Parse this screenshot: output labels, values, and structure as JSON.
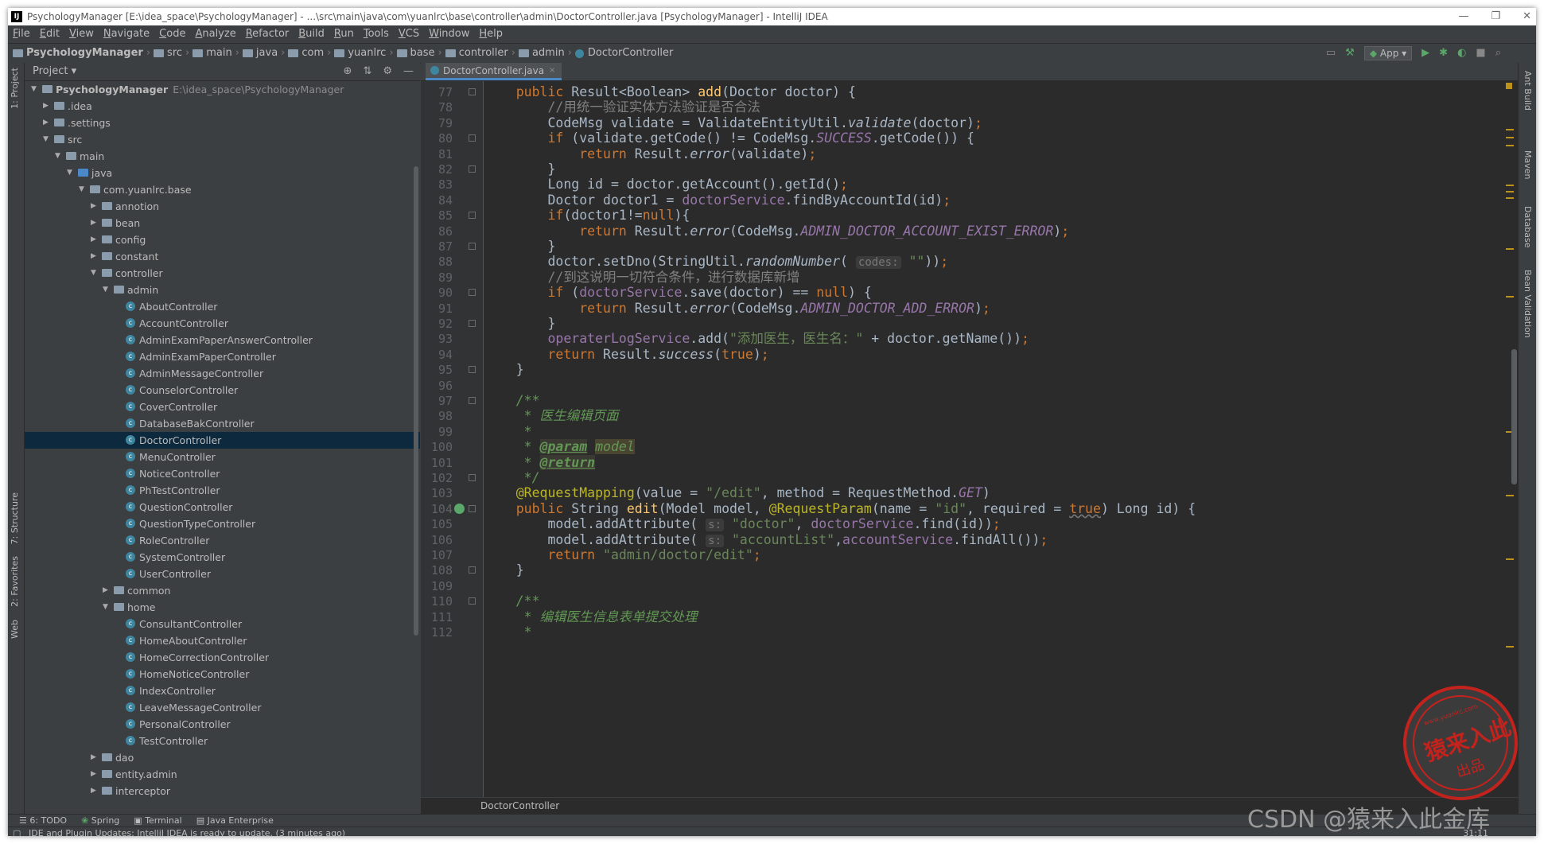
{
  "window": {
    "title": "PsychologyManager [E:\\idea_space\\PsychologyManager] - ...\\src\\main\\java\\com\\yuanlrc\\base\\controller\\admin\\DoctorController.java [PsychologyManager] - IntelliJ IDEA",
    "app_icon": "IJ",
    "min": "—",
    "restore": "❐",
    "close": "✕"
  },
  "menu": [
    "File",
    "Edit",
    "View",
    "Navigate",
    "Code",
    "Analyze",
    "Refactor",
    "Build",
    "Run",
    "Tools",
    "VCS",
    "Window",
    "Help"
  ],
  "navbar": {
    "crumbs": [
      "PsychologyManager",
      "src",
      "main",
      "java",
      "com",
      "yuanlrc",
      "base",
      "controller",
      "admin"
    ],
    "current": "DoctorController",
    "run_config": "App",
    "tool_icons": [
      "layout-icon",
      "hammer-icon"
    ],
    "run_icons": [
      "run-icon",
      "debug-icon",
      "coverage-icon",
      "stop-icon",
      "search-icon"
    ]
  },
  "left_tabs": [
    "1: Project",
    "7: Structure",
    "2: Favorites",
    "Web"
  ],
  "right_tabs": [
    "Ant Build",
    "Maven",
    "Database",
    "Bean Validation"
  ],
  "project": {
    "title": "Project",
    "dropdown": "▾",
    "tree": [
      {
        "depth": 0,
        "type": "proj",
        "label": "PsychologyManager",
        "path": "E:\\idea_space\\PsychologyManager",
        "arrow": "▼",
        "bold": true
      },
      {
        "depth": 1,
        "type": "folder",
        "label": ".idea",
        "arrow": "▶"
      },
      {
        "depth": 1,
        "type": "folder",
        "label": ".settings",
        "arrow": "▶"
      },
      {
        "depth": 1,
        "type": "folder",
        "label": "src",
        "arrow": "▼"
      },
      {
        "depth": 2,
        "type": "folder",
        "label": "main",
        "arrow": "▼"
      },
      {
        "depth": 3,
        "type": "src",
        "label": "java",
        "arrow": "▼"
      },
      {
        "depth": 4,
        "type": "folder",
        "label": "com.yuanlrc.base",
        "arrow": "▼"
      },
      {
        "depth": 5,
        "type": "folder",
        "label": "annotion",
        "arrow": "▶"
      },
      {
        "depth": 5,
        "type": "folder",
        "label": "bean",
        "arrow": "▶"
      },
      {
        "depth": 5,
        "type": "folder",
        "label": "config",
        "arrow": "▶"
      },
      {
        "depth": 5,
        "type": "folder",
        "label": "constant",
        "arrow": "▶"
      },
      {
        "depth": 5,
        "type": "folder",
        "label": "controller",
        "arrow": "▼"
      },
      {
        "depth": 6,
        "type": "folder",
        "label": "admin",
        "arrow": "▼"
      },
      {
        "depth": 7,
        "type": "class",
        "label": "AboutController"
      },
      {
        "depth": 7,
        "type": "class",
        "label": "AccountController"
      },
      {
        "depth": 7,
        "type": "class",
        "label": "AdminExamPaperAnswerController"
      },
      {
        "depth": 7,
        "type": "class",
        "label": "AdminExamPaperController"
      },
      {
        "depth": 7,
        "type": "class",
        "label": "AdminMessageController"
      },
      {
        "depth": 7,
        "type": "class",
        "label": "CounselorController"
      },
      {
        "depth": 7,
        "type": "class",
        "label": "CoverController"
      },
      {
        "depth": 7,
        "type": "class",
        "label": "DatabaseBakController"
      },
      {
        "depth": 7,
        "type": "class",
        "label": "DoctorController",
        "selected": true
      },
      {
        "depth": 7,
        "type": "class",
        "label": "MenuController"
      },
      {
        "depth": 7,
        "type": "class",
        "label": "NoticeController"
      },
      {
        "depth": 7,
        "type": "class",
        "label": "PhTestController"
      },
      {
        "depth": 7,
        "type": "class",
        "label": "QuestionController"
      },
      {
        "depth": 7,
        "type": "class",
        "label": "QuestionTypeController"
      },
      {
        "depth": 7,
        "type": "class",
        "label": "RoleController"
      },
      {
        "depth": 7,
        "type": "class",
        "label": "SystemController"
      },
      {
        "depth": 7,
        "type": "class",
        "label": "UserController"
      },
      {
        "depth": 6,
        "type": "folder",
        "label": "common",
        "arrow": "▶"
      },
      {
        "depth": 6,
        "type": "folder",
        "label": "home",
        "arrow": "▼"
      },
      {
        "depth": 7,
        "type": "class",
        "label": "ConsultantController"
      },
      {
        "depth": 7,
        "type": "class",
        "label": "HomeAboutController"
      },
      {
        "depth": 7,
        "type": "class",
        "label": "HomeCorrectionController"
      },
      {
        "depth": 7,
        "type": "class",
        "label": "HomeNoticeController"
      },
      {
        "depth": 7,
        "type": "class",
        "label": "IndexController"
      },
      {
        "depth": 7,
        "type": "class",
        "label": "LeaveMessageController"
      },
      {
        "depth": 7,
        "type": "class",
        "label": "PersonalController"
      },
      {
        "depth": 7,
        "type": "class",
        "label": "TestController"
      },
      {
        "depth": 5,
        "type": "folder",
        "label": "dao",
        "arrow": "▶"
      },
      {
        "depth": 5,
        "type": "folder",
        "label": "entity.admin",
        "arrow": "▶"
      },
      {
        "depth": 5,
        "type": "folder",
        "label": "interceptor",
        "arrow": "▶"
      }
    ]
  },
  "editor": {
    "tab": "DoctorController.java",
    "tab_close": "×",
    "bottom_breadcrumb": "DoctorController",
    "lines": [
      {
        "n": "77",
        "fold": true,
        "html": "    <span class='kw'>public</span> Result&lt;Boolean&gt; <span class='fn'>add</span>(Doctor doctor) {"
      },
      {
        "n": "78",
        "html": "        <span class='cmt'>//用统一验证实体方法验证是否合法</span>"
      },
      {
        "n": "79",
        "html": "        CodeMsg validate = ValidateEntityUtil.<span class='it'>validate</span>(doctor)<span class='kw'>;</span>"
      },
      {
        "n": "80",
        "fold": true,
        "html": "        <span class='kw'>if</span> (validate.getCode() != CodeMsg.<span class='fi'>SUCCESS</span>.getCode()) {"
      },
      {
        "n": "81",
        "html": "            <span class='kw'>return</span> Result.<span class='it'>error</span>(validate)<span class='kw'>;</span>"
      },
      {
        "n": "82",
        "fold": true,
        "html": "        }"
      },
      {
        "n": "83",
        "html": "        Long id = doctor.getAccount().getId()<span class='kw'>;</span>"
      },
      {
        "n": "84",
        "html": "        Doctor doctor1 = <span class='field'>doctorService</span>.findByAccountId(id)<span class='kw'>;</span>"
      },
      {
        "n": "85",
        "fold": true,
        "html": "        <span class='kw'>if</span>(doctor1!=<span class='kw'>null</span>){"
      },
      {
        "n": "86",
        "html": "            <span class='kw'>return</span> Result.<span class='it'>error</span>(CodeMsg.<span class='fi'>ADMIN_DOCTOR_ACCOUNT_EXIST_ERROR</span>)<span class='kw'>;</span>"
      },
      {
        "n": "87",
        "fold": true,
        "html": "        }"
      },
      {
        "n": "88",
        "html": "        doctor.setDno(StringUtil.<span class='it'>randomNumber</span>( <span class='hint'>codes:</span> <span class='str'>\"\"</span>))<span class='kw'>;</span>"
      },
      {
        "n": "89",
        "html": "        <span class='cmt'>//到这说明一切符合条件，进行数据库新增</span>"
      },
      {
        "n": "90",
        "fold": true,
        "html": "        <span class='kw'>if</span> (<span class='field'>doctorService</span>.save(doctor) == <span class='kw'>null</span>) {"
      },
      {
        "n": "91",
        "html": "            <span class='kw'>return</span> Result.<span class='it'>error</span>(CodeMsg.<span class='fi'>ADMIN_DOCTOR_ADD_ERROR</span>)<span class='kw'>;</span>"
      },
      {
        "n": "92",
        "fold": true,
        "html": "        }"
      },
      {
        "n": "93",
        "html": "        <span class='field'>operaterLogService</span>.add(<span class='str'>\"添加医生，医生名：\"</span> + doctor.getName())<span class='kw'>;</span>"
      },
      {
        "n": "94",
        "html": "        <span class='kw'>return</span> Result.<span class='it'>success</span>(<span class='kw'>true</span>)<span class='kw'>;</span>"
      },
      {
        "n": "95",
        "fold": true,
        "html": "    }"
      },
      {
        "n": "96",
        "html": ""
      },
      {
        "n": "97",
        "fold": true,
        "html": "    <span class='doc'>/**</span>"
      },
      {
        "n": "98",
        "html": "     <span class='doc'>* 医生编辑页面</span>"
      },
      {
        "n": "99",
        "html": "     <span class='doc'>*</span>"
      },
      {
        "n": "100",
        "html": "     <span class='doc'>* </span><span class='doctag'>@param</span> <span class='doc' style='background:#4a4530'>model</span>"
      },
      {
        "n": "101",
        "html": "     <span class='doc'>* </span><span class='doctag'>@return</span>"
      },
      {
        "n": "102",
        "fold": true,
        "html": "     <span class='doc'>*/</span>"
      },
      {
        "n": "103",
        "html": "    <span class='ann'>@RequestMapping</span>(value = <span class='str'>\"/edit\"</span>, method = RequestMethod.<span class='fi'>GET</span>)"
      },
      {
        "n": "104",
        "fold": true,
        "bean": true,
        "html": "    <span class='kw'>public</span> String <span class='fn'>edit</span>(Model model, <span class='ann'>@RequestParam</span>(name = <span class='str'>\"id\"</span>, required = <span class='kw' style='text-decoration:underline wavy #777'>true</span>) Long id) {"
      },
      {
        "n": "105",
        "html": "        model.addAttribute( <span class='hint'>s:</span> <span class='str'>\"doctor\"</span>, <span class='field'>doctorService</span>.find(id))<span class='kw'>;</span>"
      },
      {
        "n": "106",
        "html": "        model.addAttribute( <span class='hint'>s:</span> <span class='str'>\"accountList\"</span>,<span class='field'>accountService</span>.findAll())<span class='kw'>;</span>"
      },
      {
        "n": "107",
        "html": "        <span class='kw'>return</span> <span class='str'>\"admin/doctor/edit\"</span><span class='kw'>;</span>"
      },
      {
        "n": "108",
        "fold": true,
        "html": "    }"
      },
      {
        "n": "109",
        "html": ""
      },
      {
        "n": "110",
        "fold": true,
        "html": "    <span class='doc'>/**</span>"
      },
      {
        "n": "111",
        "html": "     <span class='doc'>* 编辑医生信息表单提交处理</span>"
      },
      {
        "n": "112",
        "html": "     <span class='doc'>*</span>"
      }
    ]
  },
  "bottom_tools": [
    "6: TODO",
    "Spring",
    "Terminal",
    "Java Enterprise"
  ],
  "status": {
    "message": "IDE and Plugin Updates: IntelliJ IDEA is ready to update. (3 minutes ago)",
    "position": "31:11"
  },
  "watermark": {
    "stamp_line1": "猿来入此",
    "stamp_line2": "出品",
    "stamp_url": "www.yuanlrc.com",
    "csdn": "CSDN @猿来入此金库"
  },
  "colors": {
    "editor_bg": "#2b2b2b",
    "panel_bg": "#3c3f41",
    "keyword": "#cc7832",
    "string": "#6a8759",
    "selection": "#0d293e"
  }
}
